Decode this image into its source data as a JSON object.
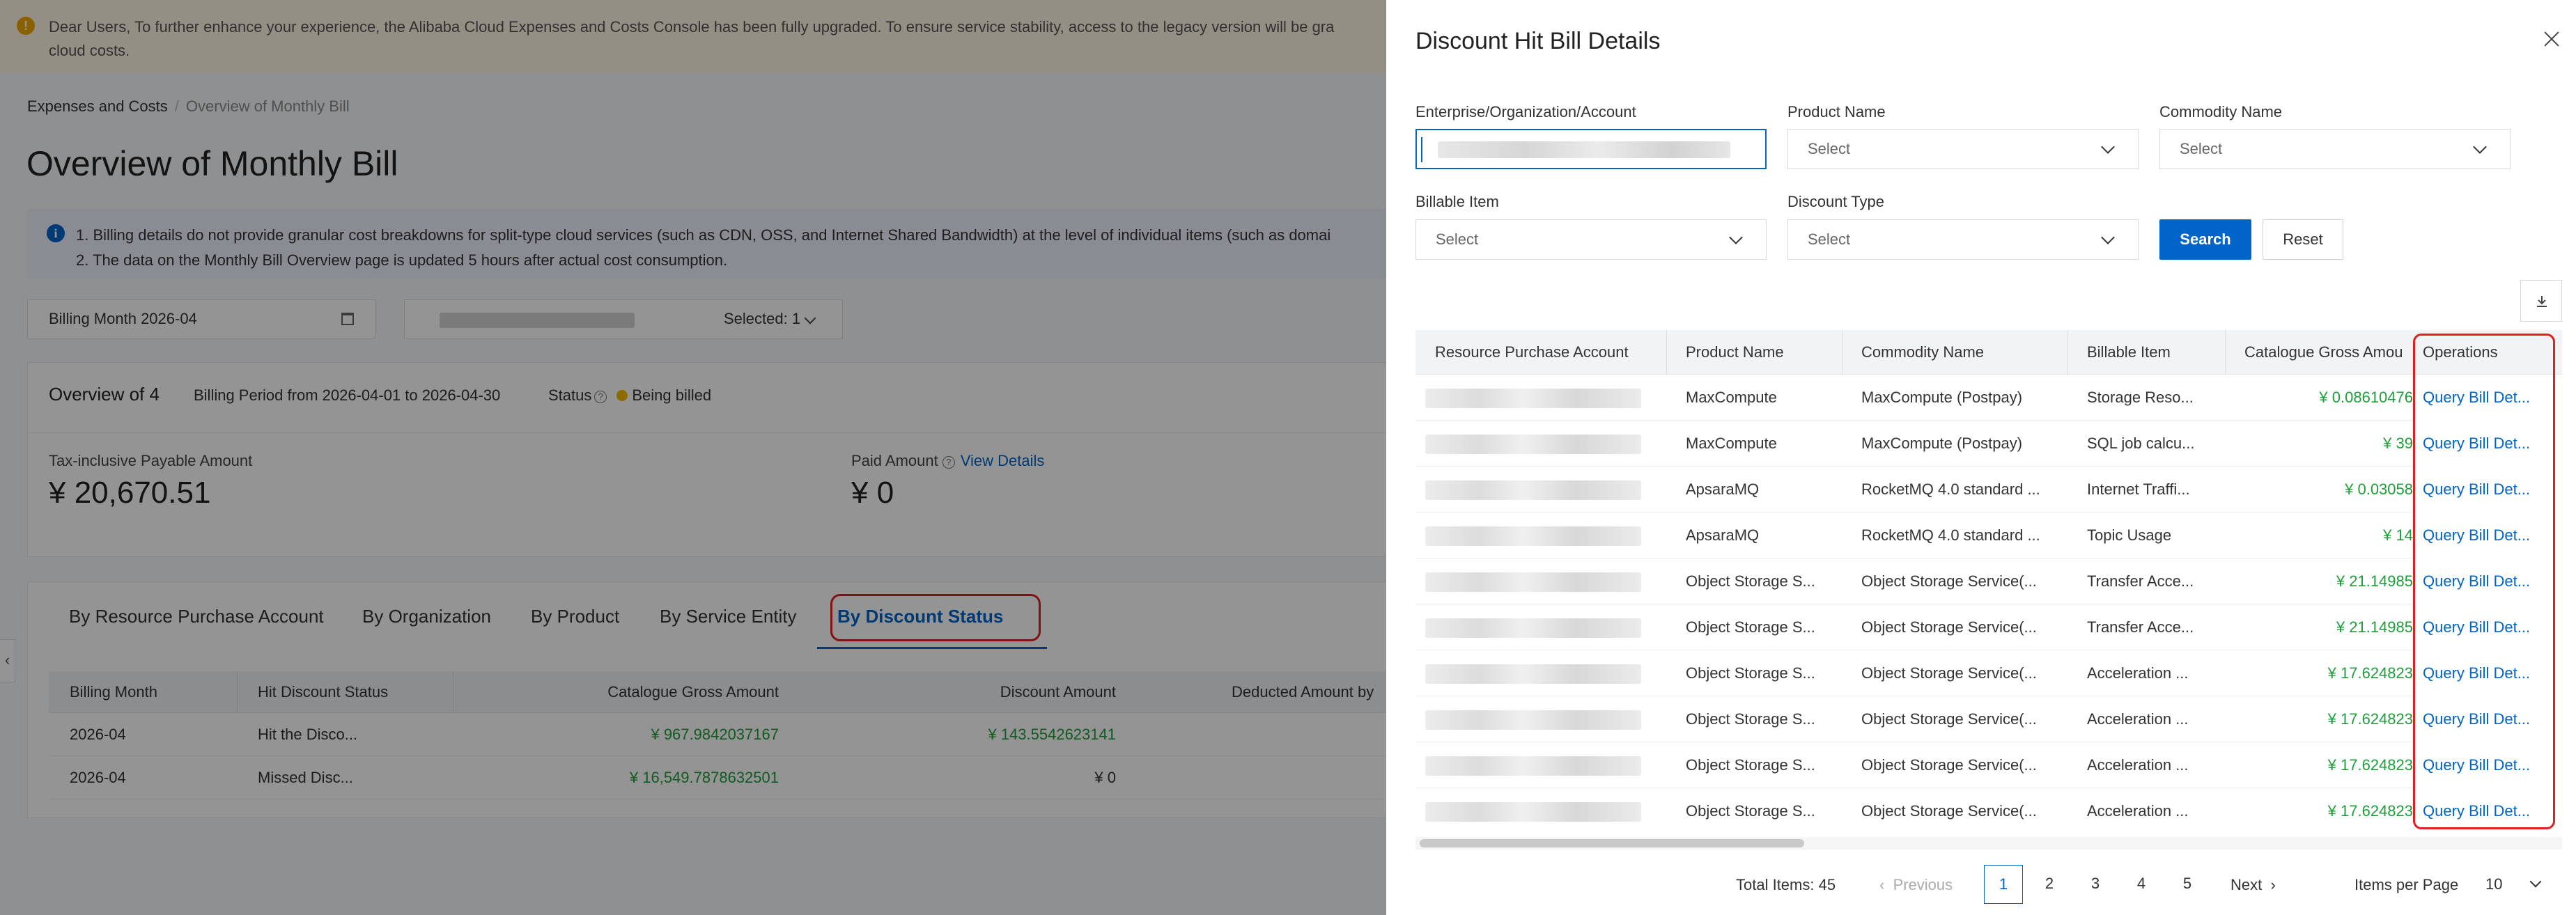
{
  "background": {
    "notice": "Dear Users, To further enhance your experience, the Alibaba Cloud Expenses and Costs Console has been fully upgraded. To ensure service stability, access to the legacy version will be gra",
    "notice_line2": "cloud costs.",
    "breadcrumb": {
      "root": "Expenses and Costs",
      "current": "Overview of Monthly Bill"
    },
    "page_title": "Overview of Monthly Bill",
    "info_lines": [
      "1. Billing details do not provide granular cost breakdowns for split-type cloud services (such as CDN, OSS, and Internet Shared Bandwidth) at the level of individual items (such as domai",
      "2. The data on the Monthly Bill Overview page is updated 5 hours after actual cost consumption."
    ],
    "billing_month": "Billing Month 2026-04",
    "account_selected": "Selected: 1",
    "overview": {
      "title": "Overview of 4",
      "period": "Billing Period from 2026-04-01 to 2026-04-30",
      "status_label": "Status",
      "status_value": "Being billed",
      "tax_label": "Tax-inclusive Payable Amount",
      "tax_value": "¥ 20,670.51",
      "paid_label": "Paid Amount",
      "paid_link": "View Details",
      "paid_value": "¥ 0"
    },
    "tabs": [
      {
        "label": "By Resource Purchase Account"
      },
      {
        "label": "By Organization"
      },
      {
        "label": "By Product"
      },
      {
        "label": "By Service Entity"
      },
      {
        "label": "By Discount Status"
      }
    ],
    "table": {
      "headers": [
        "Billing Month",
        "Hit Discount Status",
        "Catalogue Gross Amount",
        "Discount Amount",
        "Deducted Amount by"
      ],
      "rows": [
        {
          "month": "2026-04",
          "status": "Hit the Disco...",
          "gross": "¥ 967.9842037167",
          "discount": "¥ 143.5542623141"
        },
        {
          "month": "2026-04",
          "status": "Missed Disc...",
          "gross": "¥ 16,549.7878632501",
          "discount": "¥ 0"
        }
      ]
    }
  },
  "drawer": {
    "title": "Discount Hit Bill Details",
    "filters": {
      "account_label": "Enterprise/Organization/Account",
      "product_label": "Product Name",
      "product_placeholder": "Select",
      "commodity_label": "Commodity Name",
      "commodity_placeholder": "Select",
      "billable_label": "Billable Item",
      "billable_placeholder": "Select",
      "discount_label": "Discount Type",
      "discount_placeholder": "Select",
      "search": "Search",
      "reset": "Reset"
    },
    "table": {
      "headers": [
        "Resource Purchase Account",
        "Product Name",
        "Commodity Name",
        "Billable Item",
        "Catalogue Gross Amou",
        "Operations"
      ],
      "rows": [
        {
          "product": "MaxCompute",
          "commodity": "MaxCompute (Postpay)",
          "item": "Storage Reso...",
          "amount": "¥ 0.08610476",
          "op": "Query Bill Det..."
        },
        {
          "product": "MaxCompute",
          "commodity": "MaxCompute (Postpay)",
          "item": "SQL job calcu...",
          "amount": "¥ 39",
          "op": "Query Bill Det..."
        },
        {
          "product": "ApsaraMQ",
          "commodity": "RocketMQ 4.0 standard ...",
          "item": "Internet Traffi...",
          "amount": "¥ 0.03058",
          "op": "Query Bill Det..."
        },
        {
          "product": "ApsaraMQ",
          "commodity": "RocketMQ 4.0 standard ...",
          "item": "Topic Usage",
          "amount": "¥ 14",
          "op": "Query Bill Det..."
        },
        {
          "product": "Object Storage S...",
          "commodity": "Object Storage Service(...",
          "item": "Transfer Acce...",
          "amount": "¥ 21.14985",
          "op": "Query Bill Det..."
        },
        {
          "product": "Object Storage S...",
          "commodity": "Object Storage Service(...",
          "item": "Transfer Acce...",
          "amount": "¥ 21.14985",
          "op": "Query Bill Det..."
        },
        {
          "product": "Object Storage S...",
          "commodity": "Object Storage Service(...",
          "item": "Acceleration ...",
          "amount": "¥ 17.624823",
          "op": "Query Bill Det..."
        },
        {
          "product": "Object Storage S...",
          "commodity": "Object Storage Service(...",
          "item": "Acceleration ...",
          "amount": "¥ 17.624823",
          "op": "Query Bill Det..."
        },
        {
          "product": "Object Storage S...",
          "commodity": "Object Storage Service(...",
          "item": "Acceleration ...",
          "amount": "¥ 17.624823",
          "op": "Query Bill Det..."
        },
        {
          "product": "Object Storage S...",
          "commodity": "Object Storage Service(...",
          "item": "Acceleration ...",
          "amount": "¥ 17.624823",
          "op": "Query Bill Det..."
        }
      ]
    },
    "pagination": {
      "total": "Total Items: 45",
      "previous": "Previous",
      "pages": [
        "1",
        "2",
        "3",
        "4",
        "5"
      ],
      "current_page": "1",
      "next": "Next",
      "items_per_page_label": "Items per Page",
      "items_per_page": "10"
    }
  },
  "colors": {
    "primary": "#0064c8",
    "amount_green": "#1e9e3a",
    "highlight_red": "#e02020",
    "notice_bg": "#fff7e6"
  }
}
